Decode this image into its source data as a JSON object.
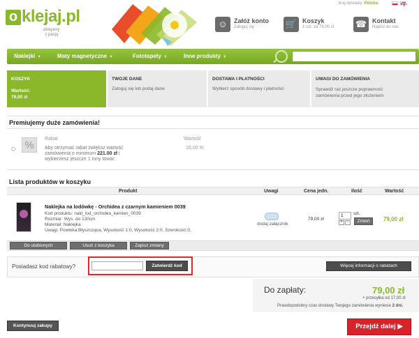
{
  "header": {
    "logo_letter": "o",
    "logo_name": "klejaj.pl",
    "logo_tagline": "oklejamy\nz pasją",
    "delivery_label": "kraj dostawy:",
    "delivery_country": "Polska",
    "account": {
      "title": "Załóż konto",
      "subtitle": "Zaloguj się"
    },
    "cart": {
      "title": "Koszyk",
      "subtitle": "1 szt. za 79,00 zł"
    },
    "contact": {
      "title": "Kontakt",
      "subtitle": "Napisz do nas"
    }
  },
  "nav": {
    "items": [
      "Naklejki",
      "Maty magnetyczne",
      "Fototapety",
      "Inne produkty"
    ],
    "search_placeholder": ""
  },
  "steps": [
    {
      "title": "KOSZYK",
      "desc": "Wartość:\n79,00 zł"
    },
    {
      "title": "TWOJE DANE",
      "desc": "Zaloguj się lub podaj dane"
    },
    {
      "title": "DOSTAWA I PŁATNOŚCI",
      "desc": "Wybierz sposób dostawy i płatności"
    },
    {
      "title": "UWAGI DO ZAMÓWIENIA",
      "desc": "Sprawdź raz jeszcze poprawność\nzamówienia przed jego złożeniem"
    }
  ],
  "premium": {
    "heading": "Premiujemy duże zamówienia!",
    "badge_symbol": "%",
    "rabat_label": "Rabat",
    "rabat_text_1": "Aby otrzymać rabat zwiększ wartość",
    "rabat_text_2": "zamówienia o minimum",
    "rabat_amount": "221.00 zł",
    "rabat_text_3": "i",
    "rabat_text_4": "wybierzesz jeszcze 1 inny towar.",
    "value_label": "Wartość",
    "value": "10.00 %"
  },
  "cart_list": {
    "heading": "Lista produktów w koszyku",
    "columns": [
      "Produkt",
      "Uwagi",
      "Cena jedn.",
      "Ilość",
      "Wartość"
    ],
    "product": {
      "name": "Naklejka na lodówkę - Orchidea z czarnym kamieniem 0039",
      "code": "Kod produktu: nakl_lod_orchidea_kamien_0039",
      "size": "Rozmiar: Wys. do 130cm",
      "material": "Materiał: Naklejka",
      "notes": "Uwagi: Powłoka:Błyszcząca, Wysokość 1:0, Wysokość 2:0, Szerokość:0,",
      "attach": "dodaj załącznik",
      "unit_price": "79,00 zł",
      "qty": "1",
      "qty_unit": "szt.",
      "change": "Zmień",
      "total": "79,00 zł"
    },
    "buttons": [
      "Do ulubionych",
      "Usuń z koszyka",
      "Zapisz zmiany"
    ]
  },
  "coupon": {
    "label": "Posiadasz kod rabatowy?",
    "input_value": "",
    "apply": "Zatwierdź kod",
    "more_info": "Więcej informacji o rabatach"
  },
  "summary": {
    "label": "Do zapłaty:",
    "amount": "79,00 zł",
    "shipping": "+ przesyłka od 17,00 zł",
    "delivery_note": "Prawdopodobny czas dostawy Twojego zamówienia wyniesie",
    "delivery_days": "2 dni."
  },
  "footer": {
    "continue": "Kontynuuj zakupy",
    "next": "Przejdź dalej"
  },
  "colors": {
    "brand_green": "#8bb82a",
    "cta_red": "#d9232a",
    "highlight": "#e1262d"
  }
}
